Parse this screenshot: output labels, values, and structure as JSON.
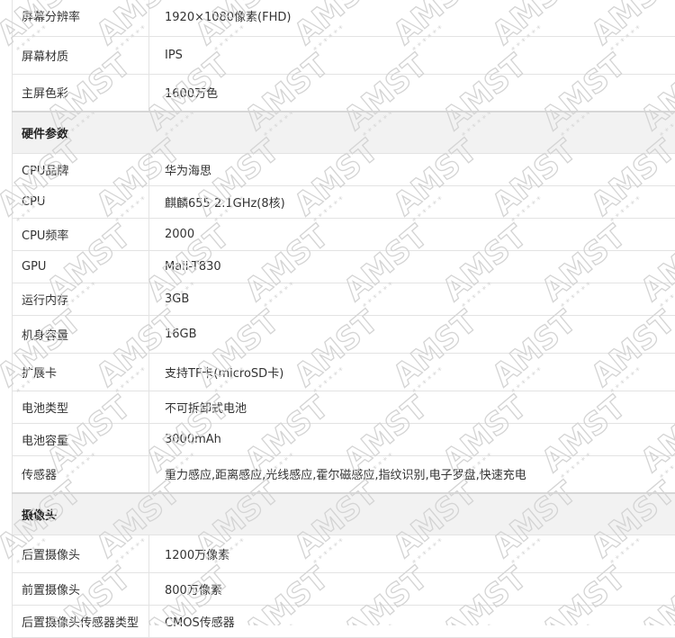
{
  "rows": [
    {
      "type": "row",
      "label": "屏幕分辨率",
      "value": "1920×1080像素(FHD)",
      "h": 44
    },
    {
      "type": "row",
      "label": "屏幕材质",
      "value": "IPS",
      "h": 42
    },
    {
      "type": "row",
      "label": "主屏色彩",
      "value": "1600万色",
      "h": 42
    },
    {
      "type": "section",
      "label": "硬件参数",
      "h": 46
    },
    {
      "type": "row",
      "label": "CPU品牌",
      "value": "华为海思",
      "h": 36
    },
    {
      "type": "row",
      "label": "CPU",
      "value": "麒麟655 2.1GHz(8核)",
      "h": 36
    },
    {
      "type": "row",
      "label": "CPU频率",
      "value": "2000",
      "h": 36
    },
    {
      "type": "row",
      "label": "GPU",
      "value": "Mali-T830",
      "h": 36
    },
    {
      "type": "row",
      "label": "运行内存",
      "value": "3GB",
      "h": 36
    },
    {
      "type": "row",
      "label": "机身容量",
      "value": "16GB",
      "h": 42
    },
    {
      "type": "row",
      "label": "扩展卡",
      "value": "支持TF卡(microSD卡)",
      "h": 42
    },
    {
      "type": "row",
      "label": "电池类型",
      "value": "不可拆卸式电池",
      "h": 36
    },
    {
      "type": "row",
      "label": "电池容量",
      "value": "3000mAh",
      "h": 36
    },
    {
      "type": "row",
      "label": "传感器",
      "value": "重力感应,距离感应,光线感应,霍尔磁感应,指纹识别,电子罗盘,快速充电",
      "h": 42
    },
    {
      "type": "section",
      "label": "摄像头",
      "h": 46
    },
    {
      "type": "row",
      "label": "后置摄像头",
      "value": "1200万像素",
      "h": 42
    },
    {
      "type": "row",
      "label": "前置摄像头",
      "value": "800万像素",
      "h": 36
    },
    {
      "type": "row",
      "label": "后置摄像头传感器类型",
      "value": "CMOS传感器",
      "h": 36
    }
  ],
  "watermark": {
    "text": "AMST",
    "dots": "* * * * * *"
  }
}
